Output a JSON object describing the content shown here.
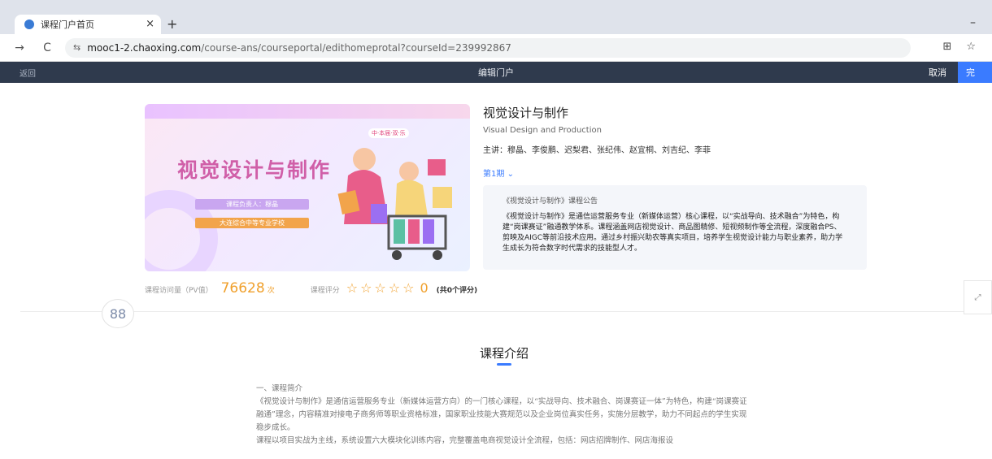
{
  "browser": {
    "tab_title": "课程门户首页",
    "tab_close": "×",
    "new_tab": "+",
    "url_domain": "mooc1-2.chaoxing.com",
    "url_path": "/course-ans/courseportal/edithomeprotal?courseId=239992867"
  },
  "editor": {
    "back_label": "返回",
    "title": "编辑门户",
    "cancel_label": "取消",
    "confirm_label": "完"
  },
  "banner": {
    "big_title": "视觉设计与制作",
    "tag_teacher": "课程负责人：穆晶",
    "tag_school": "大连综合中等专业学校",
    "chip": "中·本届·双·乐"
  },
  "course": {
    "title": "视觉设计与制作",
    "title_en": "Visual Design and Production",
    "teachers": "主讲：穆晶、李俊鹏、迟梨君、张纪伟、赵宜桐、刘吉纪、李菲",
    "term": "第1期"
  },
  "notice": {
    "title": "《视觉设计与制作》课程公告",
    "body": "《视觉设计与制作》是通信运营服务专业（新媒体运营）核心课程，以“实战导向、技术融合”为特色，构建“岗课赛证”融通教学体系。课程涵盖网店视觉设计、商品图精修、短视频制作等全流程，深度融合PS、剪映及AIGC等前沿技术应用。通过乡村振兴助农等真实项目，培养学生视觉设计能力与职业素养，助力学生成长为符合数字时代需求的技能型人才。"
  },
  "stats": {
    "pv_label": "课程访问量（PV值）",
    "pv_value": "76628",
    "pv_unit": "次",
    "rating_label": "课程评分",
    "rating_stars": "☆☆☆☆☆",
    "rating_score": "0",
    "rating_count": "(共0个评分)"
  },
  "intro": {
    "section_title": "课程介绍",
    "heading": "一、课程简介",
    "para1": "《视觉设计与制作》是通信运营服务专业（新媒体运营方向）的一门核心课程，以“实战导向、技术融合、岗课赛证一体”为特色，构建“岗课赛证融通”理念，内容精准对接电子商务师等职业资格标准，国家职业技能大赛规范以及企业岗位真实任务，实施分层教学，助力不同起点的学生实现稳步成长。",
    "para2": "课程以项目实战为主线，系统设置六大模块化训练内容，完整覆盖电商视觉设计全流程，包括：网店招牌制作、网店海报设"
  },
  "icons": {
    "app_grid": "88",
    "side": "⤢",
    "back": "→",
    "reload": "C",
    "site": "⇆",
    "star": "☆",
    "translate": "⊞",
    "minimize": "–",
    "window": "▫"
  },
  "colors": {
    "accent": "#3a7bff",
    "pv_orange": "#f0a02c",
    "editbar": "#2f3a4d",
    "banner_title": "#d05fa8"
  }
}
